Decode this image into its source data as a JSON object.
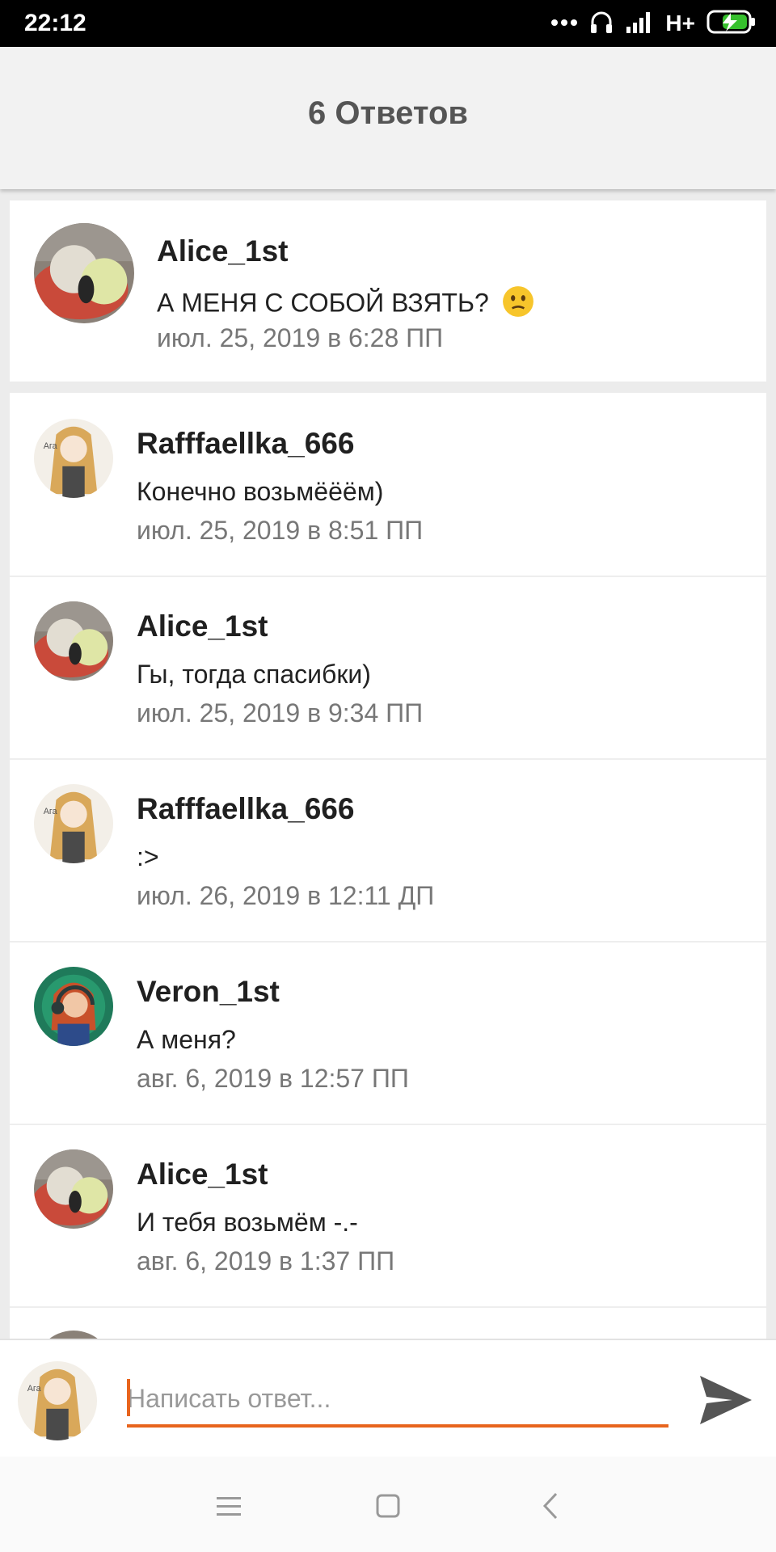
{
  "status_bar": {
    "time": "22:12",
    "network": "H+",
    "icons": [
      "more-dots-icon",
      "headphones-icon",
      "signal-icon",
      "battery-charging-icon"
    ]
  },
  "header": {
    "title": "6 Ответов"
  },
  "original_post": {
    "author": "Alice_1st",
    "text": "А МЕНЯ С СОБОЙ ВЗЯТЬ?",
    "emoji": "confused-face-emoji",
    "time": "июл. 25, 2019 в 6:28 ПП",
    "avatar": "ice-cream-avatar"
  },
  "replies": [
    {
      "author": "Rafffaellka_666",
      "text": "Конечно возьмёёём)",
      "time": "июл. 25, 2019 в 8:51 ПП",
      "avatar": "anime-girl-avatar"
    },
    {
      "author": "Alice_1st",
      "text": "Гы, тогда спасибки)",
      "time": "июл. 25, 2019 в 9:34 ПП",
      "avatar": "ice-cream-avatar"
    },
    {
      "author": "Rafffaellka_666",
      "text": ":>",
      "time": "июл. 26, 2019 в 12:11 ДП",
      "avatar": "anime-girl-avatar"
    },
    {
      "author": "Veron_1st",
      "text": "А меня?",
      "time": "авг. 6, 2019 в 12:57 ПП",
      "avatar": "headphones-girl-avatar"
    },
    {
      "author": "Alice_1st",
      "text": "И тебя возьмём -.-",
      "time": "авг. 6, 2019 в 1:37 ПП",
      "avatar": "ice-cream-avatar"
    }
  ],
  "composer": {
    "placeholder": "Написать ответ...",
    "value": "",
    "send_icon": "send-icon",
    "accent": "#e8641d"
  },
  "nav_bar": {
    "icons": [
      "menu-icon",
      "home-icon",
      "back-icon"
    ]
  }
}
